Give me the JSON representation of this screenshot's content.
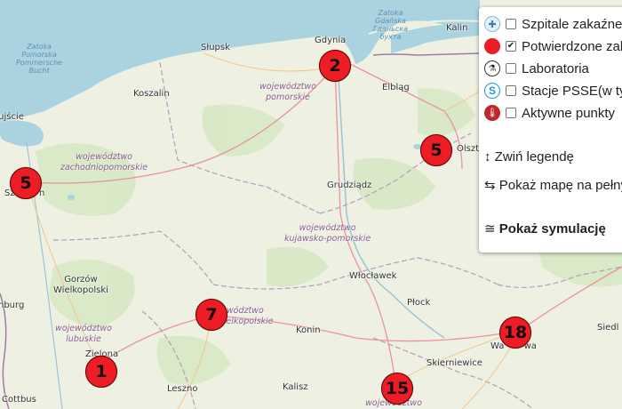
{
  "map": {
    "places": {
      "kaliningrad": "Kalin",
      "gdynia": "Gdynia",
      "slupsk": "Słupsk",
      "koszalin": "Koszalin",
      "elblag": "Elbląg",
      "olsztyn": "Olszt",
      "ujscie": "oujście",
      "szczecin_part": "Sz",
      "szczecin_part2": "n",
      "grudziadz": "Grudziądz",
      "wloclawek": "Włocławek",
      "plock": "Płock",
      "gorzow": "Gorzów\nWielkopolski",
      "konin": "Konin",
      "skierniewice": "Skierniewice",
      "warszawa": "Wa       wa",
      "siedl": "Siedl",
      "zielona": "Zielona",
      "leszno": "Leszno",
      "kalisz": "Kalisz",
      "cottbus": "Cottbus",
      "brandenburg": "nburg"
    },
    "regions": {
      "pomorskie": "województwo\npomorskie",
      "zachodniopomorskie": "województwo\nzachodniopomorskie",
      "kujawsko": "województwo\nkujawsko-pomorskie",
      "lubuskie": "województwo\nlubuskie",
      "wielkopolskie": "wództwo\nwielkopolskie",
      "lodzkie": "województwo"
    },
    "water": {
      "zatoka_pom": "Zatoka\nPomorska\nPommersche\nBucht",
      "zatoka_gd": "Zatoka\nGdańska\nГданьска\nбухта"
    },
    "markers": [
      {
        "id": "gdansk",
        "count": "2"
      },
      {
        "id": "szczecin",
        "count": "5"
      },
      {
        "id": "olsztyn",
        "count": "5"
      },
      {
        "id": "poznan",
        "count": "7"
      },
      {
        "id": "warszawa",
        "count": "18"
      },
      {
        "id": "zielona-gora",
        "count": "1"
      },
      {
        "id": "lodz",
        "count": "15"
      }
    ]
  },
  "legend": {
    "items": [
      {
        "label": "Szpitale zakaźne",
        "icon": "hospital-icon",
        "checked": false
      },
      {
        "label": "Potwierdzone zakażenia",
        "icon": "confirmed-cases-icon",
        "checked": true
      },
      {
        "label": "Laboratoria",
        "icon": "microscope-icon",
        "checked": false
      },
      {
        "label": "Stacje PSSE(w tym)",
        "icon": "psse-icon",
        "checked": false
      },
      {
        "label": "Aktywne punkty",
        "icon": "thermometer-icon",
        "checked": false
      }
    ],
    "collapse": "Zwiń legendę",
    "fullmap": "Pokaż mapę na pełnym ekranie",
    "simulation": "Pokaż symulację",
    "colors": {
      "confirmed": "#ee1c24",
      "psse": "#1a9ad6",
      "thermo": "#c0282d"
    }
  }
}
